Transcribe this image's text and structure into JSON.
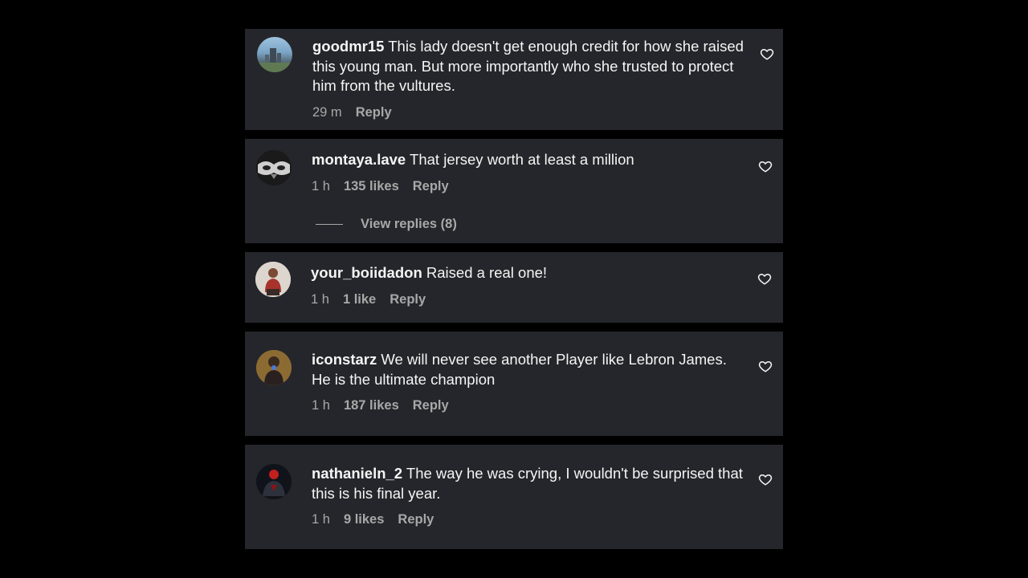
{
  "comments": [
    {
      "username": "goodmr15",
      "text": "This lady doesn't get enough credit for how she raised this young man. But more importantly who she trusted to protect him from the vultures.",
      "time": "29 m",
      "likes": "",
      "reply_label": "Reply",
      "avatar_icon": "avatar-city-skyline"
    },
    {
      "username": "montaya.lave",
      "text": "That jersey worth at least a million",
      "time": "1 h",
      "likes": "135 likes",
      "reply_label": "Reply",
      "view_replies": "View replies (8)",
      "avatar_icon": "avatar-face-monochrome"
    },
    {
      "username": "your_boiidadon",
      "text": "Raised a real one!",
      "time": "1 h",
      "likes": "1 like",
      "reply_label": "Reply",
      "avatar_icon": "avatar-person-sitting"
    },
    {
      "username": "iconstarz",
      "text": "We will never see another Player like Lebron James. He is the ultimate champion",
      "time": "1 h",
      "likes": "187 likes",
      "reply_label": "Reply",
      "avatar_icon": "avatar-person-dark"
    },
    {
      "username": "nathanieln_2",
      "text": "The way he was crying, I wouldn't be surprised that this is his final year.",
      "time": "1 h",
      "likes": "9 likes",
      "reply_label": "Reply",
      "avatar_icon": "avatar-red-figure"
    }
  ],
  "colors": {
    "background": "#000000",
    "card": "#25262b",
    "text": "#f5f5f5",
    "muted": "#a8a8a8"
  }
}
